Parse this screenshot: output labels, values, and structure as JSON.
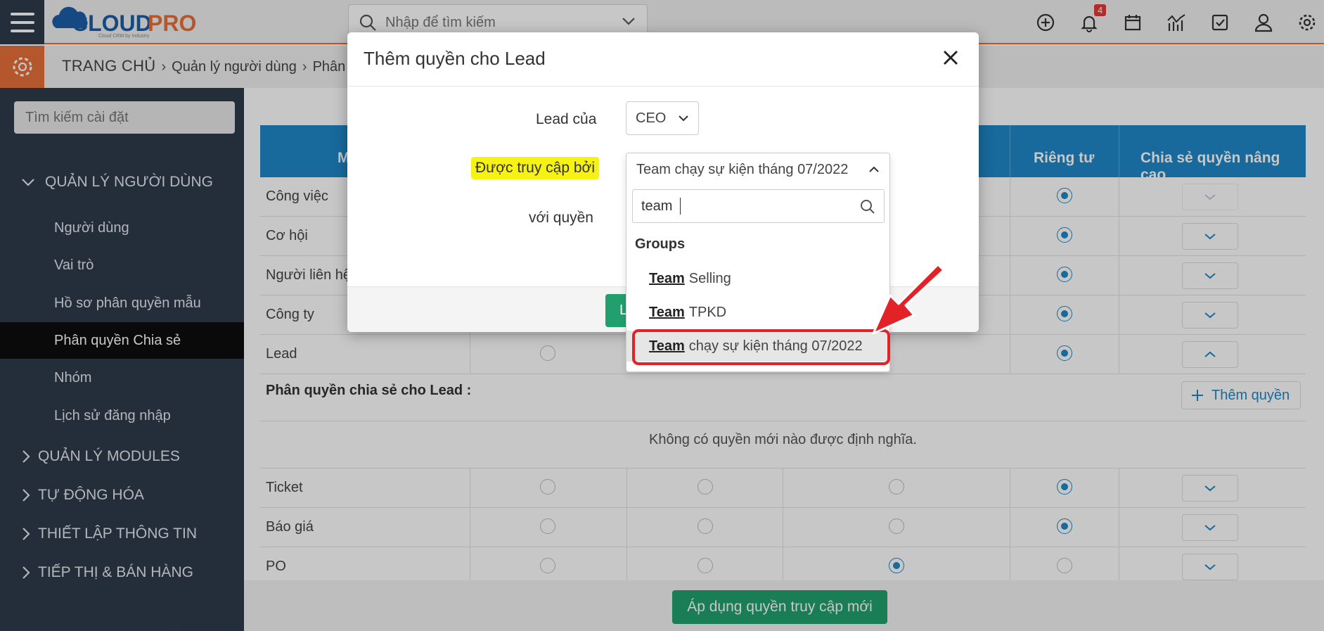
{
  "topbar": {
    "logo_text": "CLOUDPRO",
    "logo_tagline": "Cloud CRM by Industry",
    "search_placeholder": "Nhập để tìm kiếm",
    "notification_count": "4"
  },
  "breadcrumb": {
    "home": "TRANG CHỦ",
    "items": [
      "Quản lý người dùng",
      "Phân q"
    ]
  },
  "sidebar": {
    "search_placeholder": "Tìm kiếm cài đặt",
    "sections": [
      {
        "label": "QUẢN LÝ NGƯỜI DÙNG",
        "expanded": true
      },
      {
        "label": "QUẢN LÝ MODULES",
        "expanded": false
      },
      {
        "label": "TỰ ĐỘNG HÓA",
        "expanded": false
      },
      {
        "label": "THIẾT LẬP THÔNG TIN",
        "expanded": false
      },
      {
        "label": "TIẾP THỊ & BÁN HÀNG",
        "expanded": false
      }
    ],
    "items": [
      "Người dùng",
      "Vai trò",
      "Hồ sơ phân quyền mẫu",
      "Phân quyền Chia sẻ",
      "Nhóm",
      "Lịch sử đăng nhập"
    ],
    "active_item": "Phân quyền Chia sẻ"
  },
  "table": {
    "headers": [
      "M",
      "Riêng tư",
      "Chia sẻ quyền nâng cao"
    ],
    "rows": [
      "Công việc",
      "Cơ hội",
      "Người liên hệ",
      "Công ty",
      "Lead"
    ],
    "lead_section_title": "Phân quyền chia sẻ cho Lead :",
    "add_rule_label": "Thêm quyền",
    "empty_message": "Không có quyền mới nào được định nghĩa.",
    "rows_bottom": [
      "Ticket",
      "Báo giá",
      "PO"
    ],
    "apply_button": "Áp dụng quyền truy cập mới"
  },
  "modal": {
    "title": "Thêm quyền cho Lead",
    "field_lead_of_label": "Lead của",
    "field_lead_of_value": "CEO",
    "field_access_label": "Được truy cập bởi",
    "field_access_value": "Team chạy sự kiện tháng 07/2022",
    "field_permission_label": "với quyền",
    "save_button_partial": "L"
  },
  "dropdown": {
    "search_value": "team",
    "group_label": "Groups",
    "options": [
      {
        "bold": "Team",
        "rest": "Selling"
      },
      {
        "bold": "Team",
        "rest": "TPKD"
      },
      {
        "bold": "Team",
        "rest": "chạy sự kiện tháng 07/2022"
      }
    ]
  },
  "colors": {
    "accent_orange": "#e8703a",
    "header_blue": "#1e88c7",
    "sidebar_bg": "#2f3b4c",
    "green_button": "#21a06e",
    "highlight_yellow": "#f6f312",
    "annotation_red": "#e32227"
  }
}
